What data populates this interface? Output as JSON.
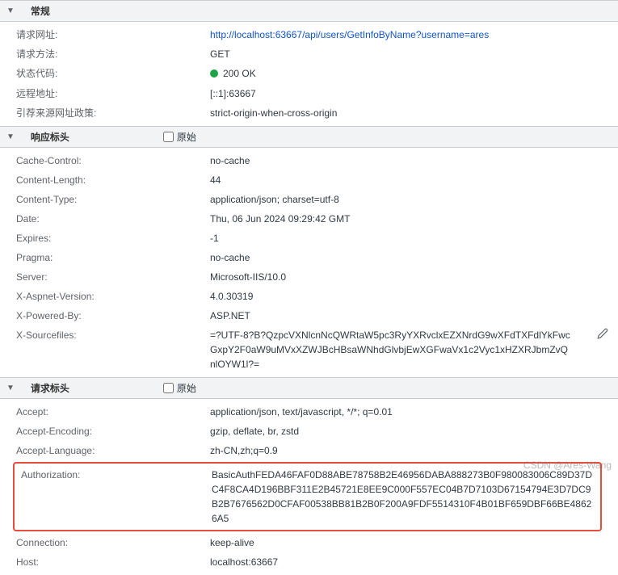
{
  "sections": {
    "general": {
      "title": "常规",
      "rows": [
        {
          "label": "请求网址:",
          "value": "http://localhost:63667/api/users/GetInfoByName?username=ares",
          "link": true
        },
        {
          "label": "请求方法:",
          "value": "GET"
        },
        {
          "label": "状态代码:",
          "value": "200 OK",
          "status": true
        },
        {
          "label": "远程地址:",
          "value": "[::1]:63667"
        },
        {
          "label": "引荐来源网址政策:",
          "value": "strict-origin-when-cross-origin"
        }
      ]
    },
    "response": {
      "title": "响应标头",
      "raw_label": "原始",
      "rows": [
        {
          "label": "Cache-Control:",
          "value": "no-cache"
        },
        {
          "label": "Content-Length:",
          "value": "44"
        },
        {
          "label": "Content-Type:",
          "value": "application/json; charset=utf-8"
        },
        {
          "label": "Date:",
          "value": "Thu, 06 Jun 2024 09:29:42 GMT"
        },
        {
          "label": "Expires:",
          "value": "-1"
        },
        {
          "label": "Pragma:",
          "value": "no-cache"
        },
        {
          "label": "Server:",
          "value": "Microsoft-IIS/10.0"
        },
        {
          "label": "X-Aspnet-Version:",
          "value": "4.0.30319"
        },
        {
          "label": "X-Powered-By:",
          "value": "ASP.NET"
        },
        {
          "label": "X-Sourcefiles:",
          "value": "=?UTF-8?B?QzpcVXNlcnNcQWRtaW5pc3RyYXRvclxEZXNrdG9wXFdTXFdlYkFwcGxpY2F0aW9uMVxXZWJBcHBsaWNhdGlvbjEwXGFwaVx1c2Vyc1xHZXRJbmZvQnlOYW1l?=",
          "edit": true
        }
      ]
    },
    "request": {
      "title": "请求标头",
      "raw_label": "原始",
      "rows": [
        {
          "label": "Accept:",
          "value": "application/json, text/javascript, */*; q=0.01"
        },
        {
          "label": "Accept-Encoding:",
          "value": "gzip, deflate, br, zstd"
        },
        {
          "label": "Accept-Language:",
          "value": "zh-CN,zh;q=0.9"
        }
      ],
      "highlighted": {
        "label": "Authorization:",
        "value": "BasicAuthFEDA46FAF0D88ABE78758B2E46956DABA888273B0F980083006C89D37DC4F8CA4D196BBF311E2B45721E8EE9C000F557EC04B7D7103D67154794E3D7DC9B2B7676562D0CFAF00538BB81B2B0F200A9FDF5514310F4B01BF659DBF66BE48626A5"
      },
      "rows_after": [
        {
          "label": "Connection:",
          "value": "keep-alive"
        },
        {
          "label": "Host:",
          "value": "localhost:63667"
        }
      ]
    }
  },
  "watermark": "CSDN @Ares-Wang"
}
